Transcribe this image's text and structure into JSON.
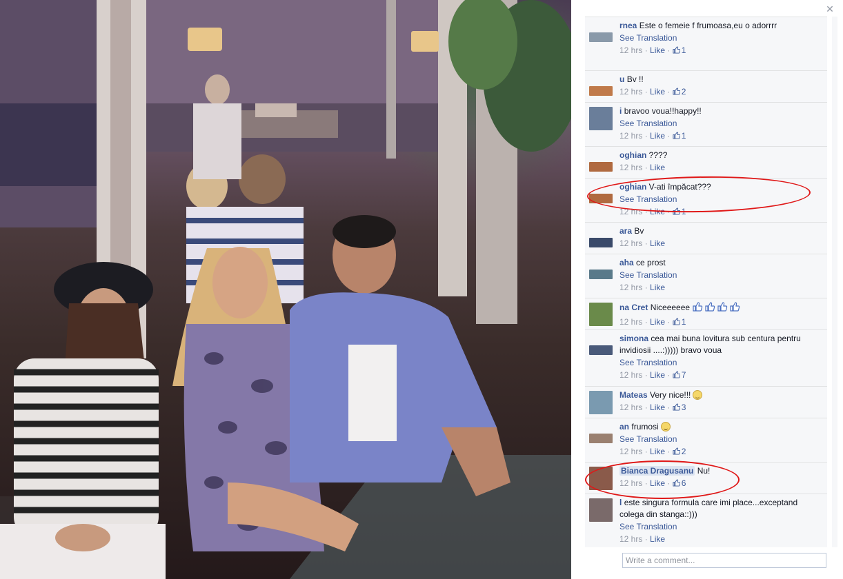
{
  "close_icon": "close-icon",
  "comments": [
    {
      "author": "rnea",
      "text": "Este o femeie f frumoasa,eu o adorrrr",
      "translate": "See Translation",
      "time": "12 hrs",
      "like": "Like",
      "likes": "1",
      "avatar_color": "#8a9aaa"
    },
    {
      "author": "u",
      "text": "Bv !!",
      "translate": "",
      "time": "12 hrs",
      "like": "Like",
      "likes": "2",
      "avatar_color": "#c07a4a"
    },
    {
      "author": "i",
      "text": "bravoo voua!!happy!!",
      "translate": "See Translation",
      "time": "12 hrs",
      "like": "Like",
      "likes": "1",
      "avatar_color": "#6a7e9a"
    },
    {
      "author": "oghian",
      "text": "????",
      "translate": "",
      "time": "12 hrs",
      "like": "Like",
      "likes": "",
      "avatar_color": "#b06a40"
    },
    {
      "author": "oghian",
      "text": "V-ati împăcat???",
      "translate": "See Translation",
      "time": "12 hrs",
      "like": "Like",
      "likes": "1",
      "avatar_color": "#b06a40"
    },
    {
      "author": "ara",
      "text": "Bv",
      "translate": "",
      "time": "12 hrs",
      "like": "Like",
      "likes": "",
      "avatar_color": "#3a4a6a"
    },
    {
      "author": "aha",
      "text": "ce prost",
      "translate": "See Translation",
      "time": "12 hrs",
      "like": "Like",
      "likes": "",
      "avatar_color": "#5a7a8a"
    },
    {
      "author": "na Cret",
      "text": "Niceeeeee",
      "translate": "",
      "time": "12 hrs",
      "like": "Like",
      "likes": "1",
      "avatar_color": "#6a8a4a"
    },
    {
      "author": "simona",
      "text": "cea mai buna lovitura sub centura pentru invidiosii ....:))))) bravo voua",
      "translate": "See Translation",
      "time": "12 hrs",
      "like": "Like",
      "likes": "7",
      "avatar_color": "#4a5a7a"
    },
    {
      "author": "Mateas",
      "text": "Very nice!!!",
      "translate": "",
      "time": "12 hrs",
      "like": "Like",
      "likes": "3",
      "avatar_color": "#7a9ab0"
    },
    {
      "author": "an",
      "text": "frumosi",
      "translate": "See Translation",
      "time": "12 hrs",
      "like": "Like",
      "likes": "2",
      "avatar_color": "#9a8070"
    },
    {
      "author": "Bianca Dragusanu",
      "text": "Nu!",
      "translate": "",
      "time": "12 hrs",
      "like": "Like",
      "likes": "6",
      "avatar_color": "#8a5a4a"
    },
    {
      "author": "l",
      "text": "este singura formula care imi place...exceptand colega din stanga::)))",
      "translate": "See Translation",
      "time": "12 hrs",
      "like": "Like",
      "likes": "",
      "avatar_color": "#7a6a6a"
    }
  ],
  "comment_input": {
    "placeholder": "Write a comment..."
  },
  "colors": {
    "link": "#3b5998",
    "meta": "#9197a3",
    "annotation": "#e01818"
  }
}
